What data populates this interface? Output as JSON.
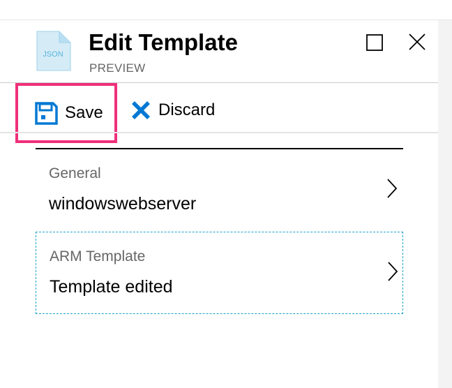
{
  "blade": {
    "icon": "json-file-icon",
    "icon_text": "JSON",
    "title": "Edit Template",
    "subtitle": "PREVIEW"
  },
  "window_controls": {
    "maximize_icon": "maximize-icon",
    "close_icon": "close-icon"
  },
  "toolbar": {
    "save_label": "Save",
    "save_icon": "save-icon",
    "discard_label": "Discard",
    "discard_icon": "discard-x-icon"
  },
  "items": [
    {
      "label": "General",
      "value": "windowswebserver",
      "icon": "chevron-right-icon"
    },
    {
      "label": "ARM Template",
      "value": "Template edited",
      "icon": "chevron-right-icon"
    }
  ],
  "colors": {
    "accent": "#0078d4",
    "highlight_border": "#f0307a",
    "focus_dashed": "#1aa3c6",
    "file_icon_fill": "#d5ecf7",
    "file_icon_text": "#59b4d9"
  }
}
